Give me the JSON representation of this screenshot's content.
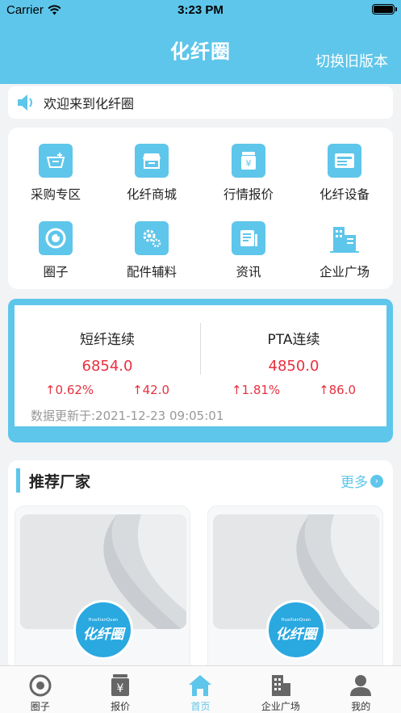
{
  "status_bar": {
    "carrier": "Carrier",
    "time": "3:23 PM"
  },
  "header": {
    "title": "化纤圈",
    "switch_label": "切换旧版本"
  },
  "notice": {
    "text": "欢迎来到化纤圈"
  },
  "grid": {
    "items": [
      {
        "label": "采购专区",
        "icon": "basket-icon"
      },
      {
        "label": "化纤商城",
        "icon": "store-icon"
      },
      {
        "label": "行情报价",
        "icon": "price-tag-icon"
      },
      {
        "label": "化纤设备",
        "icon": "device-icon"
      },
      {
        "label": "圈子",
        "icon": "circle-icon"
      },
      {
        "label": "配件辅料",
        "icon": "gears-icon"
      },
      {
        "label": "资讯",
        "icon": "news-icon"
      },
      {
        "label": "企业广场",
        "icon": "buildings-icon"
      }
    ]
  },
  "quotes": {
    "items": [
      {
        "name": "短纤连续",
        "price": "6854.0",
        "change_pct": "0.62%",
        "change_abs": "42.0"
      },
      {
        "name": "PTA连续",
        "price": "4850.0",
        "change_pct": "1.81%",
        "change_abs": "86.0"
      }
    ],
    "update_label": "数据更新于:2021-12-23 09:05:01",
    "up_arrow": "↑"
  },
  "recommend": {
    "title": "推荐厂家",
    "more_label": "更多",
    "logo_text": "化纤圈",
    "logo_small": "HuaXianQuan"
  },
  "tabbar": {
    "items": [
      {
        "label": "圈子",
        "icon": "circle-icon"
      },
      {
        "label": "报价",
        "icon": "price-tag-icon"
      },
      {
        "label": "首页",
        "icon": "home-icon"
      },
      {
        "label": "企业广场",
        "icon": "buildings-icon"
      },
      {
        "label": "我的",
        "icon": "user-icon"
      }
    ],
    "active_index": 2
  },
  "colors": {
    "accent": "#5ec6ea",
    "up": "#e8303f",
    "muted": "#999999"
  }
}
